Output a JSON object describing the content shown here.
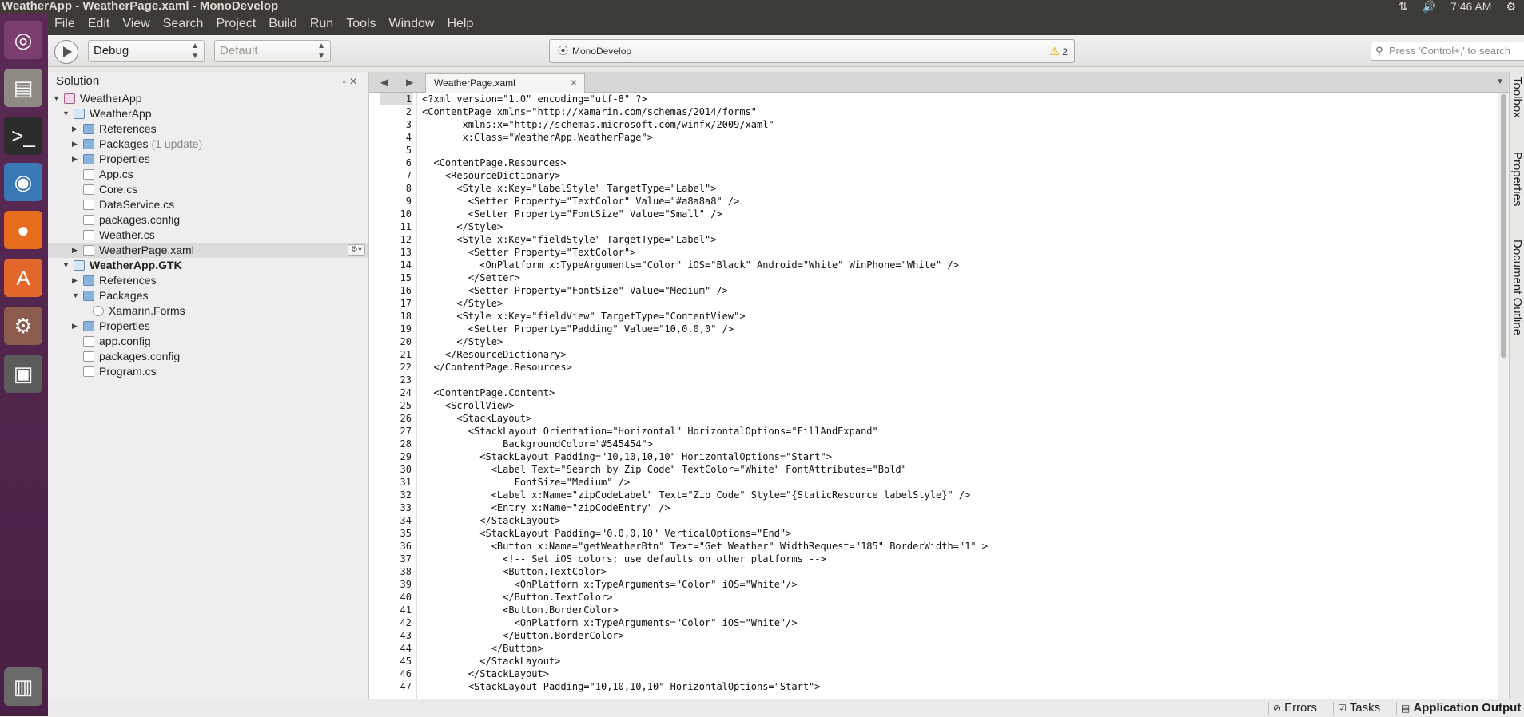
{
  "window": {
    "title": "WeatherApp - WeatherPage.xaml - MonoDevelop"
  },
  "system_tray": {
    "network_icon": "network-updown-icon",
    "volume_icon": "volume-icon",
    "clock": "7:46 AM",
    "settings_icon": "gear-icon"
  },
  "launcher": [
    {
      "name": "ubuntu-dash-icon",
      "glyph": "◎",
      "bg": "#7a3f6e"
    },
    {
      "name": "files-icon",
      "glyph": "▤",
      "bg": "#8f8b84"
    },
    {
      "name": "terminal-icon",
      "glyph": ">_",
      "bg": "#2c2c2c"
    },
    {
      "name": "monodevelop-icon",
      "glyph": "◉",
      "bg": "#3a78b5"
    },
    {
      "name": "firefox-icon",
      "glyph": "●",
      "bg": "#e86c1e"
    },
    {
      "name": "software-center-icon",
      "glyph": "A",
      "bg": "#e3672a"
    },
    {
      "name": "system-settings-icon",
      "glyph": "⚙",
      "bg": "#8b5c4e"
    },
    {
      "name": "save-disk-icon",
      "glyph": "▣",
      "bg": "#5b5b5b"
    },
    {
      "name": "trash-icon",
      "glyph": "▥",
      "bg": "#6a6a6a"
    }
  ],
  "menubar": [
    "File",
    "Edit",
    "View",
    "Search",
    "Project",
    "Build",
    "Run",
    "Tools",
    "Window",
    "Help"
  ],
  "toolbar": {
    "configuration": "Debug",
    "target": "Default",
    "status_text": "MonoDevelop",
    "warning_count": "2",
    "search_placeholder": "Press 'Control+,' to search"
  },
  "solution": {
    "title": "Solution",
    "items": [
      {
        "label": "WeatherApp",
        "indent": 0,
        "expander": "▼",
        "icon": "sln",
        "bold": false
      },
      {
        "label": "WeatherApp",
        "indent": 1,
        "expander": "▼",
        "icon": "proj",
        "bold": false
      },
      {
        "label": "References",
        "indent": 2,
        "expander": "▶",
        "icon": "folder",
        "bold": false
      },
      {
        "label": "Packages",
        "extra": "(1 update)",
        "indent": 2,
        "expander": "▶",
        "icon": "folder",
        "bold": false
      },
      {
        "label": "Properties",
        "indent": 2,
        "expander": "▶",
        "icon": "folder",
        "bold": false
      },
      {
        "label": "App.cs",
        "indent": 2,
        "expander": "",
        "icon": "file",
        "bold": false
      },
      {
        "label": "Core.cs",
        "indent": 2,
        "expander": "",
        "icon": "file",
        "bold": false
      },
      {
        "label": "DataService.cs",
        "indent": 2,
        "expander": "",
        "icon": "file",
        "bold": false
      },
      {
        "label": "packages.config",
        "indent": 2,
        "expander": "",
        "icon": "file",
        "bold": false
      },
      {
        "label": "Weather.cs",
        "indent": 2,
        "expander": "",
        "icon": "file",
        "bold": false
      },
      {
        "label": "WeatherPage.xaml",
        "indent": 2,
        "expander": "▶",
        "icon": "file",
        "bold": false,
        "selected": true
      },
      {
        "label": "WeatherApp.GTK",
        "indent": 1,
        "expander": "▼",
        "icon": "proj",
        "bold": true
      },
      {
        "label": "References",
        "indent": 2,
        "expander": "▶",
        "icon": "folder",
        "bold": false
      },
      {
        "label": "Packages",
        "indent": 2,
        "expander": "▼",
        "icon": "folder",
        "bold": false
      },
      {
        "label": "Xamarin.Forms",
        "indent": 3,
        "expander": "",
        "icon": "pkg",
        "bold": false
      },
      {
        "label": "Properties",
        "indent": 2,
        "expander": "▶",
        "icon": "folder",
        "bold": false
      },
      {
        "label": "app.config",
        "indent": 2,
        "expander": "",
        "icon": "file",
        "bold": false
      },
      {
        "label": "packages.config",
        "indent": 2,
        "expander": "",
        "icon": "file",
        "bold": false
      },
      {
        "label": "Program.cs",
        "indent": 2,
        "expander": "",
        "icon": "file",
        "bold": false
      }
    ]
  },
  "editor": {
    "tab_label": "WeatherPage.xaml",
    "current_line": 1,
    "lines": [
      "<?xml version=\"1.0\" encoding=\"utf-8\" ?>",
      "<ContentPage xmlns=\"http://xamarin.com/schemas/2014/forms\"",
      "       xmlns:x=\"http://schemas.microsoft.com/winfx/2009/xaml\"",
      "       x:Class=\"WeatherApp.WeatherPage\">",
      "",
      "  <ContentPage.Resources>",
      "    <ResourceDictionary>",
      "      <Style x:Key=\"labelStyle\" TargetType=\"Label\">",
      "        <Setter Property=\"TextColor\" Value=\"#a8a8a8\" />",
      "        <Setter Property=\"FontSize\" Value=\"Small\" />",
      "      </Style>",
      "      <Style x:Key=\"fieldStyle\" TargetType=\"Label\">",
      "        <Setter Property=\"TextColor\">",
      "          <OnPlatform x:TypeArguments=\"Color\" iOS=\"Black\" Android=\"White\" WinPhone=\"White\" />",
      "        </Setter>",
      "        <Setter Property=\"FontSize\" Value=\"Medium\" />",
      "      </Style>",
      "      <Style x:Key=\"fieldView\" TargetType=\"ContentView\">",
      "        <Setter Property=\"Padding\" Value=\"10,0,0,0\" />",
      "      </Style>",
      "    </ResourceDictionary>",
      "  </ContentPage.Resources>",
      "",
      "  <ContentPage.Content>",
      "    <ScrollView>",
      "      <StackLayout>",
      "        <StackLayout Orientation=\"Horizontal\" HorizontalOptions=\"FillAndExpand\"",
      "              BackgroundColor=\"#545454\">",
      "          <StackLayout Padding=\"10,10,10,10\" HorizontalOptions=\"Start\">",
      "            <Label Text=\"Search by Zip Code\" TextColor=\"White\" FontAttributes=\"Bold\"",
      "                FontSize=\"Medium\" />",
      "            <Label x:Name=\"zipCodeLabel\" Text=\"Zip Code\" Style=\"{StaticResource labelStyle}\" />",
      "            <Entry x:Name=\"zipCodeEntry\" />",
      "          </StackLayout>",
      "          <StackLayout Padding=\"0,0,0,10\" VerticalOptions=\"End\">",
      "            <Button x:Name=\"getWeatherBtn\" Text=\"Get Weather\" WidthRequest=\"185\" BorderWidth=\"1\" >",
      "              <!-- Set iOS colors; use defaults on other platforms -->",
      "              <Button.TextColor>",
      "                <OnPlatform x:TypeArguments=\"Color\" iOS=\"White\"/>",
      "              </Button.TextColor>",
      "              <Button.BorderColor>",
      "                <OnPlatform x:TypeArguments=\"Color\" iOS=\"White\"/>",
      "              </Button.BorderColor>",
      "            </Button>",
      "          </StackLayout>",
      "        </StackLayout>",
      "        <StackLayout Padding=\"10,10,10,10\" HorizontalOptions=\"Start\">"
    ]
  },
  "right_dock": [
    "Toolbox",
    "Properties",
    "Document Outline"
  ],
  "status_pads": [
    "Errors",
    "Tasks",
    "Application Output"
  ]
}
